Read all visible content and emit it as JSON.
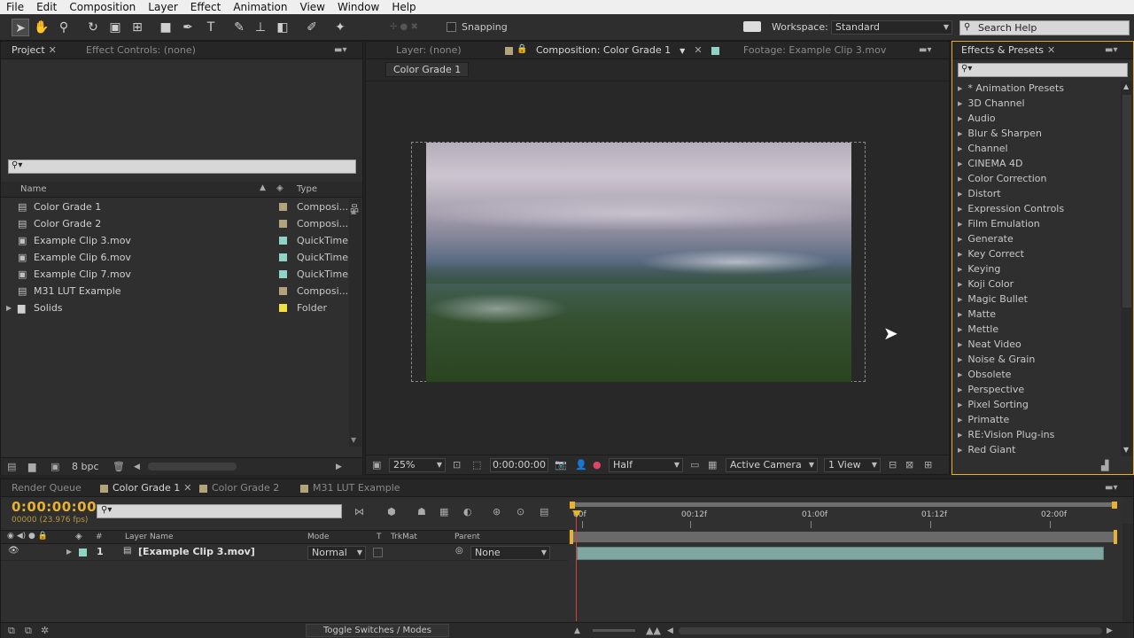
{
  "menu": [
    "File",
    "Edit",
    "Composition",
    "Layer",
    "Effect",
    "Animation",
    "View",
    "Window",
    "Help"
  ],
  "toolbar": {
    "snapping": "Snapping",
    "workspace_label": "Workspace:",
    "workspace_value": "Standard",
    "search_placeholder": "Search Help"
  },
  "project_panel": {
    "tab_project": "Project",
    "tab_effect_controls": "Effect Controls: (none)",
    "col_name": "Name",
    "col_type": "Type",
    "items": [
      {
        "name": "Color Grade 1",
        "type": "Composi...",
        "color": "#b3a37a",
        "kind": "comp"
      },
      {
        "name": "Color Grade 2",
        "type": "Composi...",
        "color": "#b3a37a",
        "kind": "comp"
      },
      {
        "name": "Example Clip 3.mov",
        "type": "QuickTime",
        "color": "#8fd3c7",
        "kind": "footage"
      },
      {
        "name": "Example Clip 6.mov",
        "type": "QuickTime",
        "color": "#8fd3c7",
        "kind": "footage"
      },
      {
        "name": "Example Clip 7.mov",
        "type": "QuickTime",
        "color": "#8fd3c7",
        "kind": "footage"
      },
      {
        "name": "M31 LUT Example",
        "type": "Composi...",
        "color": "#b3a37a",
        "kind": "comp"
      },
      {
        "name": "Solids",
        "type": "Folder",
        "color": "#f0e040",
        "kind": "folder"
      }
    ],
    "bpc": "8 bpc"
  },
  "comp_panel": {
    "tab_layer": "Layer: (none)",
    "tab_comp": "Composition: Color Grade 1",
    "tab_footage": "Footage: Example Clip 3.mov",
    "breadcrumb": "Color Grade 1",
    "zoom": "25%",
    "timecode": "0:00:00:00",
    "resolution": "Half",
    "camera": "Active Camera",
    "views": "1 View"
  },
  "effects_panel": {
    "title": "Effects & Presets",
    "items": [
      "* Animation Presets",
      "3D Channel",
      "Audio",
      "Blur & Sharpen",
      "Channel",
      "CINEMA 4D",
      "Color Correction",
      "Distort",
      "Expression Controls",
      "Film Emulation",
      "Generate",
      "Key Correct",
      "Keying",
      "Koji Color",
      "Magic Bullet",
      "Matte",
      "Mettle",
      "Neat Video",
      "Noise & Grain",
      "Obsolete",
      "Perspective",
      "Pixel Sorting",
      "Primatte",
      "RE:Vision Plug-ins",
      "Red Giant"
    ]
  },
  "timeline": {
    "tabs": [
      "Render Queue",
      "Color Grade 1",
      "Color Grade 2",
      "M31 LUT Example"
    ],
    "timecode": "0:00:00:00",
    "fps": "00000 (23.976 fps)",
    "col_hash": "#",
    "col_layer": "Layer Name",
    "col_mode": "Mode",
    "col_t": "T",
    "col_trkmat": "TrkMat",
    "col_parent": "Parent",
    "ruler": [
      "00f",
      "00:12f",
      "01:00f",
      "01:12f",
      "02:00f"
    ],
    "layer": {
      "num": "1",
      "name": "[Example Clip 3.mov]",
      "mode": "Normal",
      "parent": "None"
    },
    "toggle": "Toggle Switches / Modes"
  },
  "colors": {
    "accent_yellow": "#e8b230",
    "layer_bar": "#7fa6a0",
    "panel_bg": "#2f2f2f",
    "comp_bg": "#282828"
  }
}
